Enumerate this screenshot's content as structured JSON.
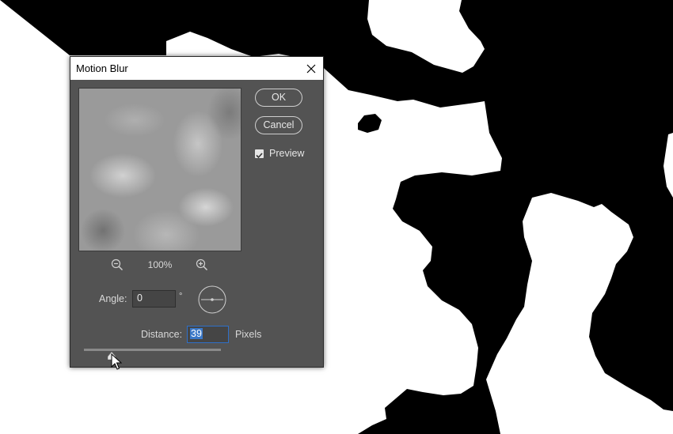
{
  "dialog": {
    "title": "Motion Blur",
    "close_icon": "close-icon"
  },
  "preview": {
    "zoom_level": "100%",
    "zoom_out_icon": "zoom-out-icon",
    "zoom_in_icon": "zoom-in-icon"
  },
  "buttons": {
    "ok_label": "OK",
    "cancel_label": "Cancel"
  },
  "preview_option": {
    "label": "Preview",
    "checked": true
  },
  "angle": {
    "label": "Angle:",
    "value": "0",
    "unit": "°",
    "dial_icon": "angle-dial-icon"
  },
  "distance": {
    "label": "Distance:",
    "value": "39",
    "unit": "Pixels",
    "slider_fraction": 0.04
  },
  "colors": {
    "dialog_bg": "#535353",
    "titlebar_bg": "#ffffff",
    "focus_border": "#2f70c8",
    "selection": "#3a78c8"
  }
}
